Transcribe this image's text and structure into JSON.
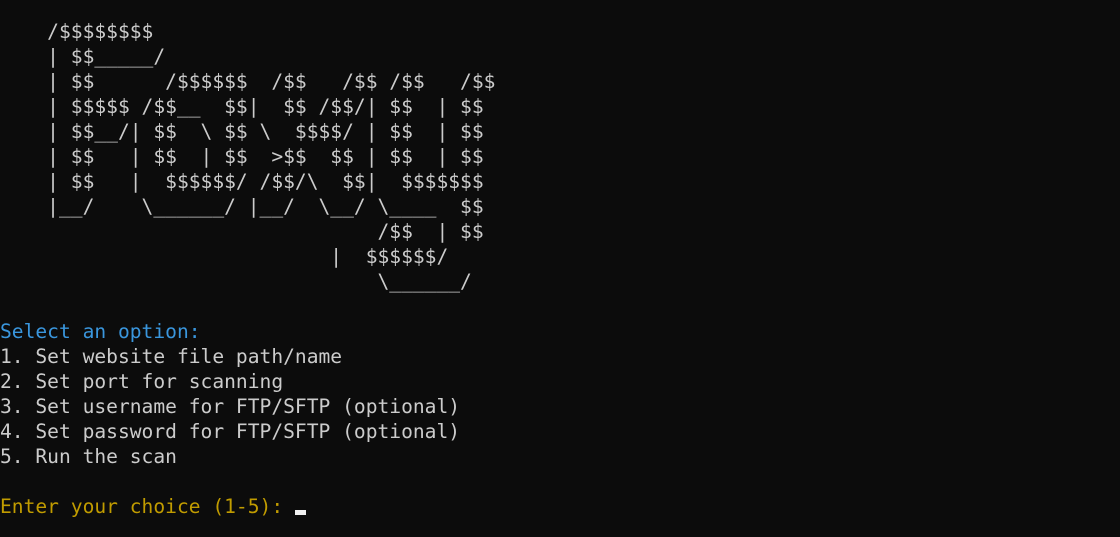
{
  "banner": {
    "lines": [
      "    /$$$$$$$$",
      "    | $$_____/",
      "    | $$      /$$$$$$  /$$   /$$ /$$   /$$",
      "    | $$$$$ /$$__  $$|  $$ /$$/| $$  | $$",
      "    | $$__/| $$  \\ $$ \\  $$$$/ | $$  | $$",
      "    | $$   | $$  | $$  >$$  $$ | $$  | $$",
      "    | $$   |  $$$$$$/ /$$/\\  $$|  $$$$$$$",
      "    |__/    \\______/ |__/  \\__/ \\____  $$",
      "                                /$$  | $$",
      "                            |  $$$$$$/",
      "                                \\______/"
    ]
  },
  "menu": {
    "heading": "Select an option:",
    "options": [
      "1. Set website file path/name",
      "2. Set port for scanning",
      "3. Set username for FTP/SFTP (optional)",
      "4. Set password for FTP/SFTP (optional)",
      "5. Run the scan"
    ]
  },
  "prompt": {
    "text": "Enter your choice (1-5): "
  },
  "colors": {
    "background": "#0c0c0c",
    "foreground": "#cccccc",
    "heading": "#3a96dd",
    "prompt": "#c19c00"
  }
}
